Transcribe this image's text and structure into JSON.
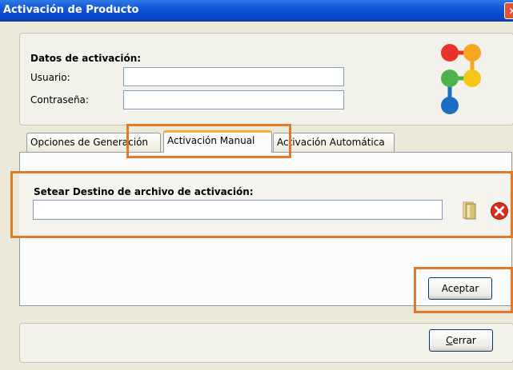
{
  "window": {
    "title": "Activación de Producto",
    "close_glyph": "✕"
  },
  "activation_data": {
    "heading": "Datos de activación:",
    "user_label": "Usuario:",
    "user_value": "",
    "password_label": "Contraseña:",
    "password_value": ""
  },
  "tabs": [
    {
      "label": "Opciones de Generación",
      "active": false
    },
    {
      "label": "Activación Manual",
      "active": true
    },
    {
      "label": "Activación Automática",
      "active": false
    }
  ],
  "manual": {
    "destination_label": "Setear Destino de archivo de activación:",
    "destination_value": "",
    "browse_icon": "folder-browse-icon",
    "clear_icon": "clear-red-x-icon"
  },
  "buttons": {
    "accept": "Aceptar",
    "close_mnemonic": "C",
    "close_rest": "errar"
  },
  "logo": {
    "dot_colors": [
      "#e8332a",
      "#f5a623",
      "#4db24a",
      "#f5c518",
      "#1a6fc4"
    ],
    "line_colors": [
      "#e8332a",
      "#f5a623",
      "#4db24a",
      "#1a6fc4"
    ]
  },
  "annotation_color": "#e07a2a"
}
